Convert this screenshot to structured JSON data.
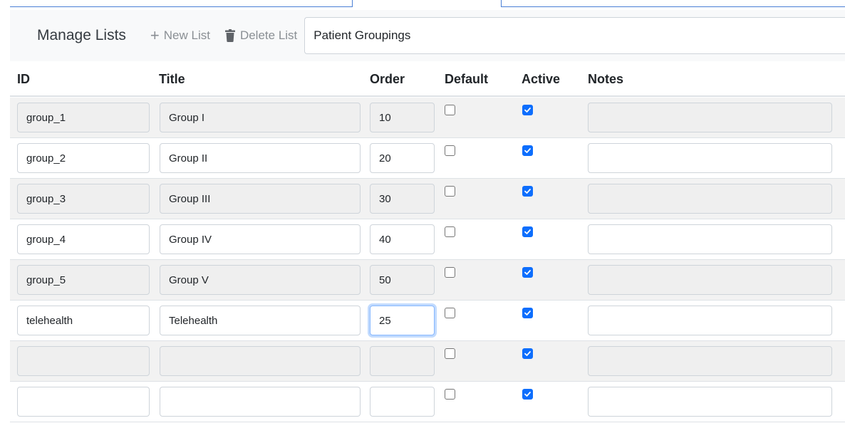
{
  "toolbar": {
    "title": "Manage Lists",
    "new_list_label": "New List",
    "delete_list_label": "Delete List",
    "selected_list": "Patient Groupings"
  },
  "columns": {
    "id": "ID",
    "title": "Title",
    "order": "Order",
    "default": "Default",
    "active": "Active",
    "notes": "Notes"
  },
  "rows": [
    {
      "id": "group_1",
      "title": "Group I",
      "order": "10",
      "default": false,
      "active": true,
      "notes": ""
    },
    {
      "id": "group_2",
      "title": "Group II",
      "order": "20",
      "default": false,
      "active": true,
      "notes": ""
    },
    {
      "id": "group_3",
      "title": "Group III",
      "order": "30",
      "default": false,
      "active": true,
      "notes": ""
    },
    {
      "id": "group_4",
      "title": "Group IV",
      "order": "40",
      "default": false,
      "active": true,
      "notes": ""
    },
    {
      "id": "group_5",
      "title": "Group V",
      "order": "50",
      "default": false,
      "active": true,
      "notes": ""
    },
    {
      "id": "telehealth",
      "title": "Telehealth",
      "order": "25",
      "default": false,
      "active": true,
      "notes": ""
    },
    {
      "id": "",
      "title": "",
      "order": "",
      "default": false,
      "active": true,
      "notes": ""
    },
    {
      "id": "",
      "title": "",
      "order": "",
      "default": false,
      "active": true,
      "notes": ""
    }
  ],
  "colors": {
    "accent": "#0d6efd",
    "focus_border": "#86b7fe",
    "stripe": "#f2f2f2"
  }
}
